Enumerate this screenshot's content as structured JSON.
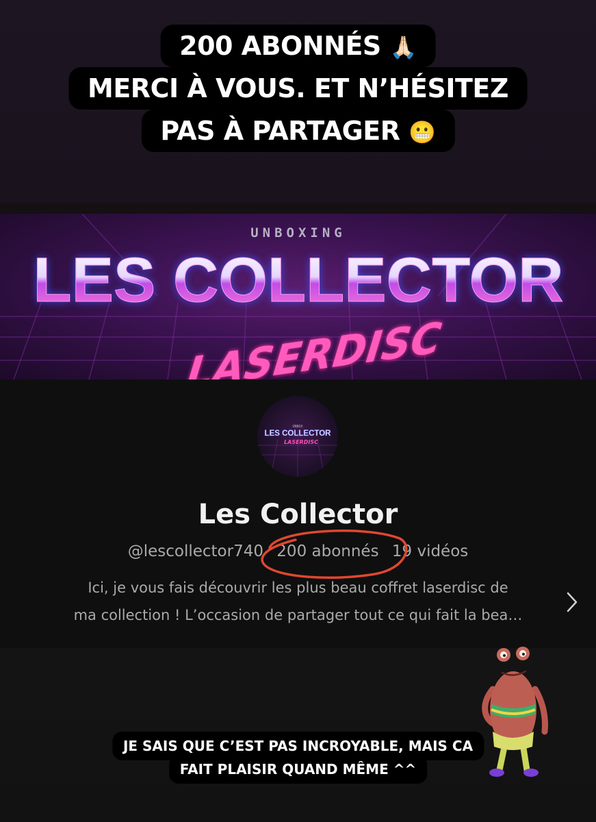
{
  "story_caption": {
    "line1": "200 ABONNÉS",
    "line1_emoji": "🙏🏻",
    "line2": "MERCI À VOUS. ET N’HÉSITEZ",
    "line3": "PAS À PARTAGER",
    "line3_emoji": "😬"
  },
  "banner": {
    "kicker": "UNBOXING",
    "title": "LES COLLECTOR",
    "subtitle": "LASERDISC",
    "colors": {
      "accent_pink": "#ff2fa0",
      "accent_purple": "#b04cff",
      "accent_blue": "#3a55ff"
    }
  },
  "avatar": {
    "small_kicker": "UNBOX",
    "title": "LES COLLECTOR",
    "subtitle": "LASERDISC"
  },
  "channel": {
    "name": "Les Collector",
    "handle": "@lescollector740",
    "subscribers": "200 abonnés",
    "videos": "19 vidéos",
    "description_line1": "Ici, je vous fais découvrir les plus beau coffret laserdisc de",
    "description_line2": "ma collection ! L’occasion de partager tout ce qui fait la bea…",
    "more_icon": "chevron-right-icon",
    "highlight_color": "#e0472e"
  },
  "bottom_caption": {
    "line1": "JE SAIS QUE C’EST PAS INCROYABLE, MAIS CA",
    "line2": "FAIT PLAISIR QUAND MÊME ^^"
  },
  "sticker": {
    "icon": "dancing-frog-sticker"
  }
}
